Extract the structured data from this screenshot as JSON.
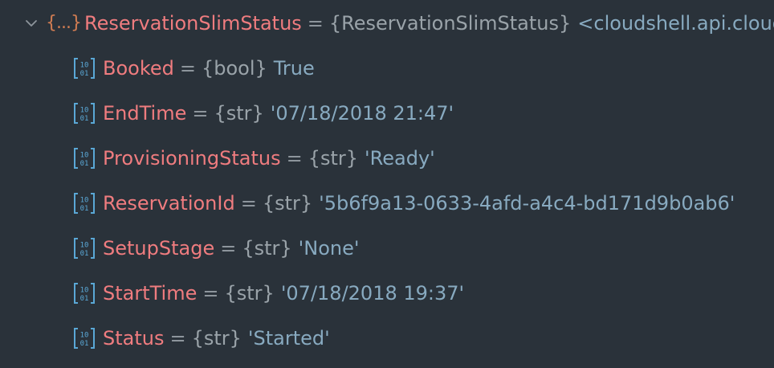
{
  "root": {
    "icon": "object-icon",
    "icon_text": "{...}",
    "name": "ReservationSlimStatus",
    "equals": "=",
    "type": "{ReservationSlimStatus}",
    "value": "<cloudshell.api.clouds"
  },
  "fields": [
    {
      "name": "Booked",
      "equals": "=",
      "type": "{bool}",
      "value": "True"
    },
    {
      "name": "EndTime",
      "equals": "=",
      "type": "{str}",
      "value": "'07/18/2018 21:47'"
    },
    {
      "name": "ProvisioningStatus",
      "equals": "=",
      "type": "{str}",
      "value": "'Ready'"
    },
    {
      "name": "ReservationId",
      "equals": "=",
      "type": "{str}",
      "value": "'5b6f9a13-0633-4afd-a4c4-bd171d9b0ab6'"
    },
    {
      "name": "SetupStage",
      "equals": "=",
      "type": "{str}",
      "value": "'None'"
    },
    {
      "name": "StartTime",
      "equals": "=",
      "type": "{str}",
      "value": "'07/18/2018 19:37'"
    },
    {
      "name": "Status",
      "equals": "=",
      "type": "{str}",
      "value": "'Started'"
    }
  ],
  "colors": {
    "background": "#2a323a",
    "name": "#ef7c7f",
    "value": "#88aac0",
    "type": "#9aa3a9",
    "object_icon": "#d07c52",
    "field_icon": "#5aa8d6"
  }
}
